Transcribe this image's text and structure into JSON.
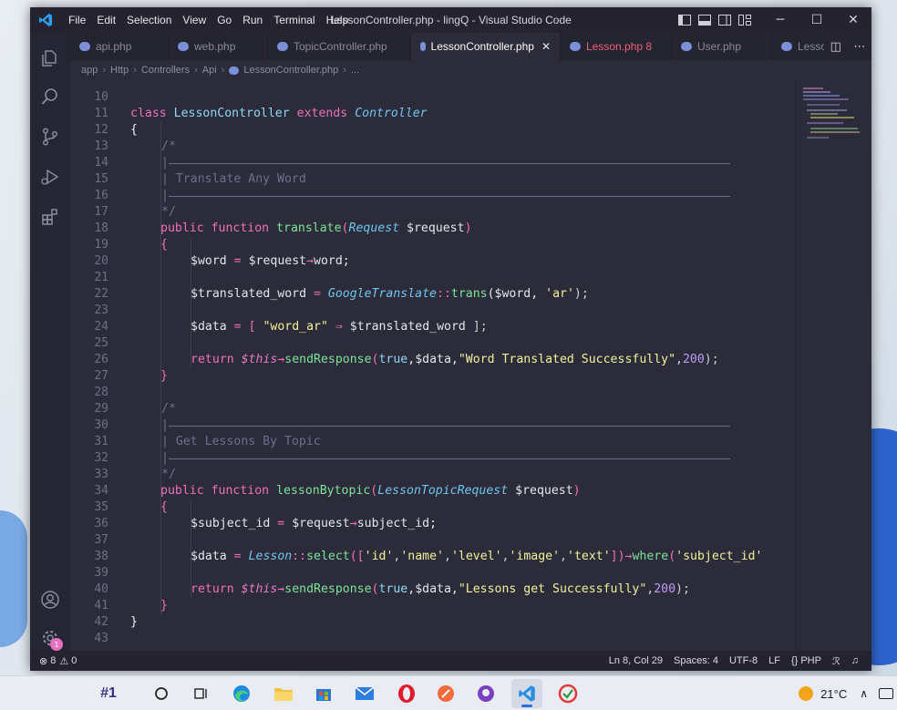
{
  "window": {
    "title": "LessonController.php - lingQ - Visual Studio Code",
    "menu": [
      "File",
      "Edit",
      "Selection",
      "View",
      "Go",
      "Run",
      "Terminal",
      "Help"
    ]
  },
  "tabs": [
    {
      "label": "api.php",
      "active": false,
      "error": false
    },
    {
      "label": "web.php",
      "active": false,
      "error": false
    },
    {
      "label": "TopicController.php",
      "active": false,
      "error": false
    },
    {
      "label": "LessonController.php",
      "active": true,
      "error": false
    },
    {
      "label": "Lesson.php 8",
      "active": false,
      "error": true
    },
    {
      "label": "User.php",
      "active": false,
      "error": false
    },
    {
      "label": "Lesso",
      "active": false,
      "error": false
    }
  ],
  "breadcrumb": [
    "app",
    "Http",
    "Controllers",
    "Api",
    "LessonController.php",
    "..."
  ],
  "editor": {
    "line_numbers": [
      "10",
      "11",
      "12",
      "13",
      "14",
      "15",
      "16",
      "17",
      "18",
      "19",
      "20",
      "21",
      "22",
      "23",
      "24",
      "25",
      "26",
      "27",
      "28",
      "29",
      "30",
      "31",
      "32",
      "33",
      "34",
      "35",
      "36",
      "37",
      "38",
      "39",
      "40",
      "41",
      "42",
      "43"
    ]
  },
  "code": {
    "l11": [
      "class",
      "LessonController",
      "extends",
      "Controller"
    ],
    "l12": "{",
    "l13": "/*",
    "l14": "|",
    "l15": "| Translate Any Word",
    "l16": "|",
    "l17": "*/",
    "l18": [
      "public",
      "function",
      "translate",
      "(",
      "Request",
      "$request",
      ")"
    ],
    "l19": "{",
    "l20": [
      "$word",
      "=",
      "$request",
      "→",
      "word;"
    ],
    "l22": [
      "$translated_word",
      "=",
      "GoogleTranslate",
      "::",
      "trans",
      "($word, ",
      "'ar'",
      ");"
    ],
    "l24": [
      "$data",
      "=",
      "[",
      "\"word_ar\"",
      "⇒",
      "$translated_word",
      "];"
    ],
    "l26": [
      "return",
      "$this",
      "→",
      "sendResponse",
      "(",
      "true",
      ",$data,",
      "\"Word Translated Successfully\"",
      ",",
      "200",
      ");"
    ],
    "l27": "}",
    "l29": "/*",
    "l30": "|",
    "l31": "| Get Lessons By Topic",
    "l32": "|",
    "l33": "*/",
    "l34": [
      "public",
      "function",
      "lessonBytopic",
      "(",
      "LessonTopicRequest",
      "$request",
      ")"
    ],
    "l35": "{",
    "l36": [
      "$subject_id",
      "=",
      "$request",
      "→",
      "subject_id;"
    ],
    "l38": [
      "$data",
      "=",
      "Lesson",
      "::",
      "select",
      "([",
      "'id'",
      ",",
      "'name'",
      ",",
      "'level'",
      ",",
      "'image'",
      ",",
      "'text'",
      "])",
      "→",
      "where",
      "(",
      "'subject_id'"
    ],
    "l40": [
      "return",
      "$this",
      "→",
      "sendResponse",
      "(",
      "true",
      ",$data,",
      "\"Lessons get Successfully\"",
      ",",
      "200",
      ");"
    ],
    "l41": "}",
    "l42": "}"
  },
  "status": {
    "errors": "8",
    "warnings": "0",
    "position": "Ln 8, Col 29",
    "spaces": "Spaces: 4",
    "encoding": "UTF-8",
    "eol": "LF",
    "language": "PHP"
  },
  "activity_badge": "1",
  "taskbar": {
    "widget_label": "#1",
    "weather": "21°C"
  }
}
